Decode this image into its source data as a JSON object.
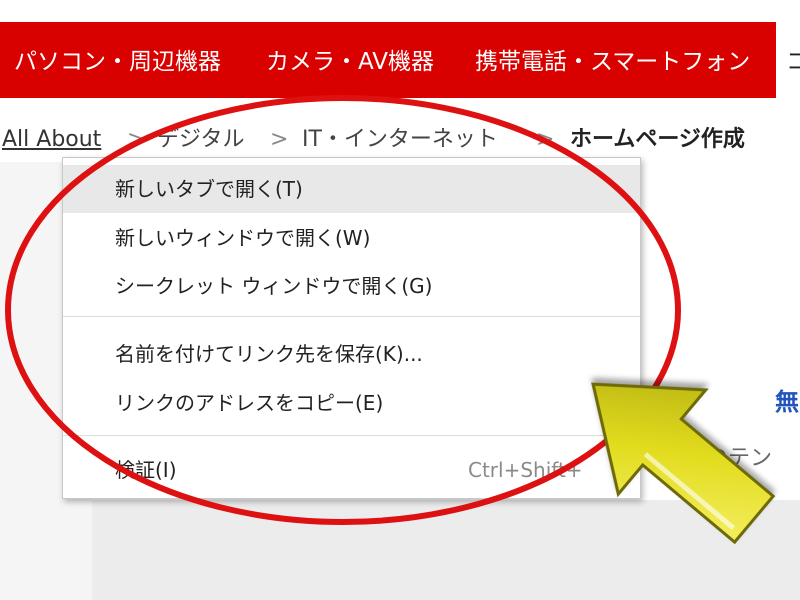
{
  "nav": {
    "items": [
      "パソコン・周辺機器",
      "カメラ・AV機器",
      "携帯電話・スマートフォン"
    ],
    "active_fragment": "コ"
  },
  "breadcrumb": {
    "items": [
      "All About",
      "デジタル",
      "IT・インターネット",
      "ホームページ作成"
    ],
    "separator": ">"
  },
  "page": {
    "blue_fragment": "無",
    "gray_fragment": "類以上のテン"
  },
  "context_menu": {
    "items": [
      {
        "label": "新しいタブで開く(T)",
        "shortcut": ""
      },
      {
        "label": "新しいウィンドウで開く(W)",
        "shortcut": ""
      },
      {
        "label": "シークレット ウィンドウで開く(G)",
        "shortcut": ""
      },
      {
        "label": "名前を付けてリンク先を保存(K)...",
        "shortcut": ""
      },
      {
        "label": "リンクのアドレスをコピー(E)",
        "shortcut": ""
      },
      {
        "label": "検証(I)",
        "shortcut": "Ctrl+Shift+"
      }
    ]
  },
  "annotation": {
    "ellipse_color": "#dd1111",
    "arrow_color": "#e8e22a"
  }
}
